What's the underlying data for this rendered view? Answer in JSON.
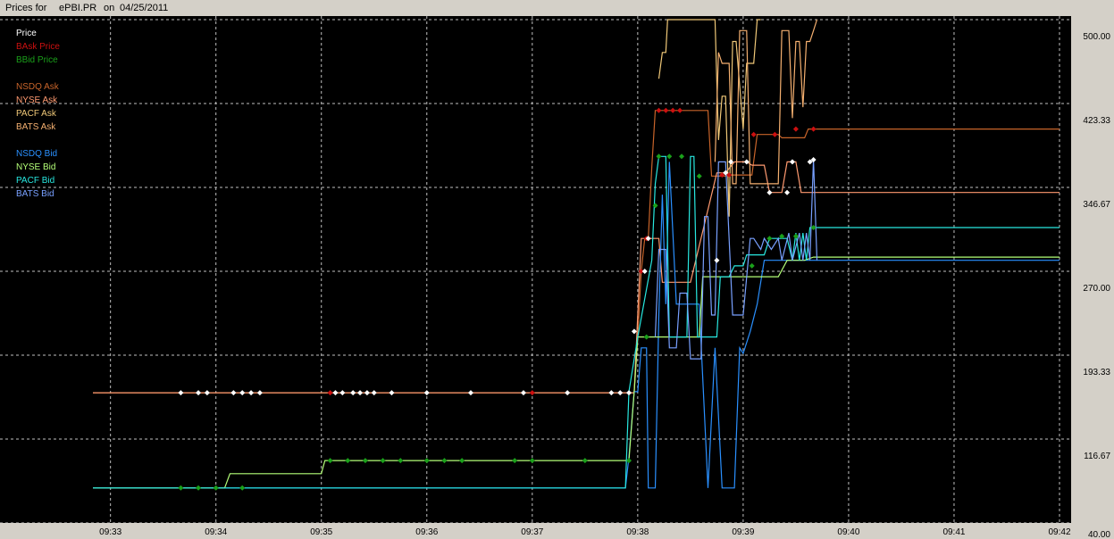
{
  "window": {
    "title_prefix": "Prices for",
    "symbol": "ePBI.PR",
    "date_prefix": "on",
    "date": "04/25/2011"
  },
  "colors": {
    "background": "#000000",
    "grid": "#bfbfbf",
    "bask": "#cc1010",
    "bbid": "#1aa01a",
    "nsdq_ask": "#c8642a",
    "nyse_ask": "#ff9a70",
    "pacf_ask": "#f0c878",
    "bats_ask": "#f5b070",
    "nsdq_bid": "#2a90ff",
    "nyse_bid": "#b4ff78",
    "pacf_bid": "#28e8e0",
    "bats_bid": "#78a0ff",
    "panel": "#d4d0c8"
  },
  "chart_data": {
    "type": "line",
    "title": "Prices for  ePBI.PR  on  04/25/2011",
    "xlabel": "",
    "ylabel": "",
    "x_ticks": [
      "09:33",
      "09:34",
      "09:35",
      "09:36",
      "09:37",
      "09:38",
      "09:39",
      "09:40",
      "09:41",
      "09:42"
    ],
    "y_ticks": [
      "500.00",
      "423.33",
      "346.67",
      "270.00",
      "193.33",
      "116.67",
      "40.00"
    ],
    "ylim": [
      40,
      500
    ],
    "xlim": [
      "09:32:50",
      "09:42:00"
    ],
    "grid": true,
    "legend_position": "top-left",
    "legend": {
      "header": "Price",
      "groups": [
        [
          "BAsk Price",
          "BBid Price"
        ],
        [
          "NSDQ Ask",
          "NYSE Ask",
          "PACF Ask",
          "BATS Ask"
        ],
        [
          "NSDQ Bid",
          "NYSE Bid",
          "PACF Bid",
          "BATS Bid"
        ]
      ]
    },
    "series": [
      {
        "name": "NSDQ Ask",
        "color_key": "nsdq_ask",
        "points": [
          [
            "09:32:50",
            159
          ],
          [
            "09:37:58",
            159
          ],
          [
            "09:38:00",
            210
          ],
          [
            "09:38:02",
            270
          ],
          [
            "09:38:04",
            300
          ],
          [
            "09:38:06",
            300
          ],
          [
            "09:38:08",
            365
          ],
          [
            "09:38:10",
            417
          ],
          [
            "09:38:40",
            417
          ],
          [
            "09:38:42",
            357
          ],
          [
            "09:38:50",
            357
          ],
          [
            "09:38:52",
            358
          ],
          [
            "09:39:05",
            358
          ],
          [
            "09:39:08",
            395
          ],
          [
            "09:39:20",
            395
          ],
          [
            "09:39:22",
            392
          ],
          [
            "09:39:35",
            392
          ],
          [
            "09:39:37",
            400
          ],
          [
            "09:42:00",
            400
          ]
        ]
      },
      {
        "name": "NYSE Ask",
        "color_key": "nyse_ask",
        "points": [
          [
            "09:32:50",
            159
          ],
          [
            "09:37:58",
            159
          ],
          [
            "09:38:02",
            300
          ],
          [
            "09:38:12",
            300
          ],
          [
            "09:38:14",
            260
          ],
          [
            "09:38:30",
            260
          ],
          [
            "09:38:45",
            360
          ],
          [
            "09:38:50",
            360
          ],
          [
            "09:38:55",
            370
          ],
          [
            "09:39:02",
            370
          ],
          [
            "09:39:05",
            367
          ],
          [
            "09:39:12",
            367
          ],
          [
            "09:39:15",
            342
          ],
          [
            "09:39:22",
            342
          ],
          [
            "09:39:25",
            370
          ],
          [
            "09:39:30",
            370
          ],
          [
            "09:39:33",
            342
          ],
          [
            "09:39:40",
            342
          ],
          [
            "09:39:42",
            342
          ],
          [
            "09:42:00",
            342
          ]
        ]
      },
      {
        "name": "PACF Ask",
        "color_key": "pacf_ask",
        "points": [
          [
            "09:38:12",
            446
          ],
          [
            "09:38:14",
            470
          ],
          [
            "09:38:16",
            470
          ],
          [
            "09:38:17",
            500
          ],
          [
            "09:38:44",
            500
          ],
          [
            "09:38:46",
            390
          ],
          [
            "09:38:48",
            430
          ],
          [
            "09:38:50",
            430
          ],
          [
            "09:38:52",
            320
          ],
          [
            "09:38:54",
            480
          ],
          [
            "09:38:56",
            480
          ],
          [
            "09:39:00",
            400
          ],
          [
            "09:39:02",
            460
          ],
          [
            "09:39:06",
            460
          ],
          [
            "09:39:08",
            500
          ],
          [
            "09:39:10",
            500
          ]
        ]
      },
      {
        "name": "BATS Ask",
        "color_key": "bats_ask",
        "points": [
          [
            "09:38:44",
            370
          ],
          [
            "09:38:46",
            470
          ],
          [
            "09:38:48",
            460
          ],
          [
            "09:38:52",
            460
          ],
          [
            "09:38:54",
            350
          ],
          [
            "09:38:56",
            350
          ],
          [
            "09:38:58",
            490
          ],
          [
            "09:39:02",
            490
          ],
          [
            "09:39:04",
            350
          ],
          [
            "09:39:20",
            350
          ],
          [
            "09:39:22",
            490
          ],
          [
            "09:39:26",
            490
          ],
          [
            "09:39:28",
            410
          ],
          [
            "09:39:30",
            480
          ],
          [
            "09:39:32",
            480
          ],
          [
            "09:39:34",
            420
          ],
          [
            "09:39:36",
            480
          ],
          [
            "09:39:38",
            480
          ],
          [
            "09:39:40",
            490
          ],
          [
            "09:39:42",
            500
          ]
        ]
      },
      {
        "name": "NSDQ Bid",
        "color_key": "nsdq_bid",
        "points": [
          [
            "09:32:50",
            72
          ],
          [
            "09:37:53",
            72
          ],
          [
            "09:37:55",
            100
          ],
          [
            "09:37:58",
            160
          ],
          [
            "09:38:00",
            160
          ],
          [
            "09:38:02",
            200
          ],
          [
            "09:38:05",
            200
          ],
          [
            "09:38:06",
            72
          ],
          [
            "09:38:10",
            72
          ],
          [
            "09:38:12",
            230
          ],
          [
            "09:38:14",
            340
          ],
          [
            "09:38:16",
            240
          ],
          [
            "09:38:18",
            370
          ],
          [
            "09:38:22",
            240
          ],
          [
            "09:38:30",
            240
          ],
          [
            "09:38:35",
            240
          ],
          [
            "09:38:40",
            72
          ],
          [
            "09:38:44",
            200
          ],
          [
            "09:38:48",
            72
          ],
          [
            "09:38:55",
            72
          ],
          [
            "09:38:58",
            200
          ],
          [
            "09:39:00",
            195
          ],
          [
            "09:39:04",
            215
          ],
          [
            "09:39:08",
            240
          ],
          [
            "09:39:12",
            280
          ],
          [
            "09:39:20",
            280
          ],
          [
            "09:39:24",
            280
          ],
          [
            "09:39:30",
            280
          ],
          [
            "09:42:00",
            280
          ]
        ]
      },
      {
        "name": "NYSE Bid",
        "color_key": "nyse_bid",
        "points": [
          [
            "09:32:50",
            72
          ],
          [
            "09:34:05",
            72
          ],
          [
            "09:34:08",
            85
          ],
          [
            "09:35:00",
            85
          ],
          [
            "09:35:02",
            97
          ],
          [
            "09:37:55",
            97
          ],
          [
            "09:37:58",
            160
          ],
          [
            "09:38:00",
            210
          ],
          [
            "09:38:35",
            210
          ],
          [
            "09:38:37",
            265
          ],
          [
            "09:38:50",
            265
          ],
          [
            "09:38:52",
            265
          ],
          [
            "09:39:20",
            265
          ],
          [
            "09:39:25",
            280
          ],
          [
            "09:39:35",
            280
          ],
          [
            "09:39:40",
            283
          ],
          [
            "09:42:00",
            283
          ]
        ]
      },
      {
        "name": "PACF Bid",
        "color_key": "pacf_bid",
        "points": [
          [
            "09:32:50",
            72
          ],
          [
            "09:37:53",
            72
          ],
          [
            "09:37:55",
            160
          ],
          [
            "09:38:00",
            210
          ],
          [
            "09:38:08",
            280
          ],
          [
            "09:38:10",
            350
          ],
          [
            "09:38:12",
            375
          ],
          [
            "09:38:16",
            375
          ],
          [
            "09:38:18",
            210
          ],
          [
            "09:38:28",
            210
          ],
          [
            "09:38:30",
            375
          ],
          [
            "09:38:32",
            375
          ],
          [
            "09:38:34",
            210
          ],
          [
            "09:38:45",
            210
          ],
          [
            "09:38:47",
            265
          ],
          [
            "09:38:52",
            265
          ],
          [
            "09:38:55",
            275
          ],
          [
            "09:39:00",
            275
          ],
          [
            "09:39:02",
            285
          ],
          [
            "09:39:12",
            285
          ],
          [
            "09:39:15",
            300
          ],
          [
            "09:39:25",
            300
          ],
          [
            "09:39:28",
            280
          ],
          [
            "09:39:30",
            305
          ],
          [
            "09:39:32",
            280
          ],
          [
            "09:39:34",
            305
          ],
          [
            "09:39:36",
            280
          ],
          [
            "09:39:38",
            310
          ],
          [
            "09:42:00",
            310
          ]
        ]
      },
      {
        "name": "BATS Bid",
        "color_key": "bats_bid",
        "points": [
          [
            "09:38:10",
            210
          ],
          [
            "09:38:12",
            290
          ],
          [
            "09:38:16",
            290
          ],
          [
            "09:38:18",
            200
          ],
          [
            "09:38:22",
            200
          ],
          [
            "09:38:24",
            250
          ],
          [
            "09:38:28",
            250
          ],
          [
            "09:38:30",
            190
          ],
          [
            "09:38:36",
            190
          ],
          [
            "09:38:38",
            320
          ],
          [
            "09:38:40",
            320
          ],
          [
            "09:38:42",
            230
          ],
          [
            "09:38:44",
            230
          ],
          [
            "09:38:46",
            370
          ],
          [
            "09:38:50",
            370
          ],
          [
            "09:38:54",
            230
          ],
          [
            "09:39:00",
            230
          ],
          [
            "09:39:04",
            300
          ],
          [
            "09:39:06",
            300
          ],
          [
            "09:39:10",
            290
          ],
          [
            "09:39:12",
            300
          ],
          [
            "09:39:16",
            290
          ],
          [
            "09:39:20",
            300
          ],
          [
            "09:39:22",
            280
          ],
          [
            "09:39:26",
            305
          ],
          [
            "09:39:28",
            280
          ],
          [
            "09:39:32",
            305
          ],
          [
            "09:39:34",
            280
          ],
          [
            "09:39:36",
            305
          ],
          [
            "09:39:38",
            280
          ],
          [
            "09:39:40",
            372
          ],
          [
            "09:39:42",
            280
          ]
        ]
      }
    ],
    "markers": [
      {
        "name": "BAsk Price",
        "color_key": "bask",
        "points": [
          [
            "09:38:48",
            358
          ],
          [
            "09:38:52",
            358
          ],
          [
            "09:39:06",
            395
          ],
          [
            "09:39:18",
            395
          ],
          [
            "09:39:30",
            400
          ],
          [
            "09:39:40",
            400
          ],
          [
            "09:38:12",
            417
          ],
          [
            "09:38:16",
            417
          ],
          [
            "09:38:20",
            417
          ],
          [
            "09:38:24",
            417
          ],
          [
            "09:38:02",
            270
          ],
          [
            "09:38:05",
            300
          ],
          [
            "09:37:00",
            159
          ],
          [
            "09:35:05",
            159
          ]
        ]
      },
      {
        "name": "BBid Price",
        "color_key": "bbid",
        "points": [
          [
            "09:33:40",
            72
          ],
          [
            "09:33:50",
            72
          ],
          [
            "09:34:00",
            72
          ],
          [
            "09:34:15",
            72
          ],
          [
            "09:35:05",
            97
          ],
          [
            "09:35:15",
            97
          ],
          [
            "09:35:25",
            97
          ],
          [
            "09:35:35",
            97
          ],
          [
            "09:35:45",
            97
          ],
          [
            "09:36:00",
            97
          ],
          [
            "09:36:10",
            97
          ],
          [
            "09:36:20",
            97
          ],
          [
            "09:36:50",
            97
          ],
          [
            "09:37:00",
            97
          ],
          [
            "09:37:30",
            97
          ],
          [
            "09:37:55",
            97
          ],
          [
            "09:38:05",
            210
          ],
          [
            "09:38:10",
            330
          ],
          [
            "09:38:12",
            375
          ],
          [
            "09:38:18",
            375
          ],
          [
            "09:38:25",
            375
          ],
          [
            "09:38:35",
            357
          ],
          [
            "09:39:05",
            275
          ],
          [
            "09:39:15",
            300
          ],
          [
            "09:39:22",
            302
          ],
          [
            "09:39:30",
            302
          ],
          [
            "09:39:40",
            310
          ]
        ]
      },
      {
        "name": "White Markers",
        "color": "#ffffff",
        "points": [
          [
            "09:33:40",
            159
          ],
          [
            "09:33:50",
            159
          ],
          [
            "09:33:55",
            159
          ],
          [
            "09:34:10",
            159
          ],
          [
            "09:34:15",
            159
          ],
          [
            "09:34:20",
            159
          ],
          [
            "09:34:25",
            159
          ],
          [
            "09:35:08",
            159
          ],
          [
            "09:35:12",
            159
          ],
          [
            "09:35:18",
            159
          ],
          [
            "09:35:22",
            159
          ],
          [
            "09:35:26",
            159
          ],
          [
            "09:35:30",
            159
          ],
          [
            "09:35:40",
            159
          ],
          [
            "09:36:00",
            159
          ],
          [
            "09:36:25",
            159
          ],
          [
            "09:36:55",
            159
          ],
          [
            "09:37:20",
            159
          ],
          [
            "09:37:45",
            159
          ],
          [
            "09:37:50",
            159
          ],
          [
            "09:37:55",
            159
          ],
          [
            "09:37:58",
            215
          ],
          [
            "09:38:06",
            300
          ],
          [
            "09:38:04",
            270
          ],
          [
            "09:38:45",
            280
          ],
          [
            "09:38:50",
            360
          ],
          [
            "09:38:53",
            370
          ],
          [
            "09:39:02",
            370
          ],
          [
            "09:39:28",
            370
          ],
          [
            "09:39:38",
            370
          ],
          [
            "09:39:40",
            372
          ],
          [
            "09:39:15",
            342
          ],
          [
            "09:39:25",
            342
          ]
        ]
      }
    ]
  }
}
